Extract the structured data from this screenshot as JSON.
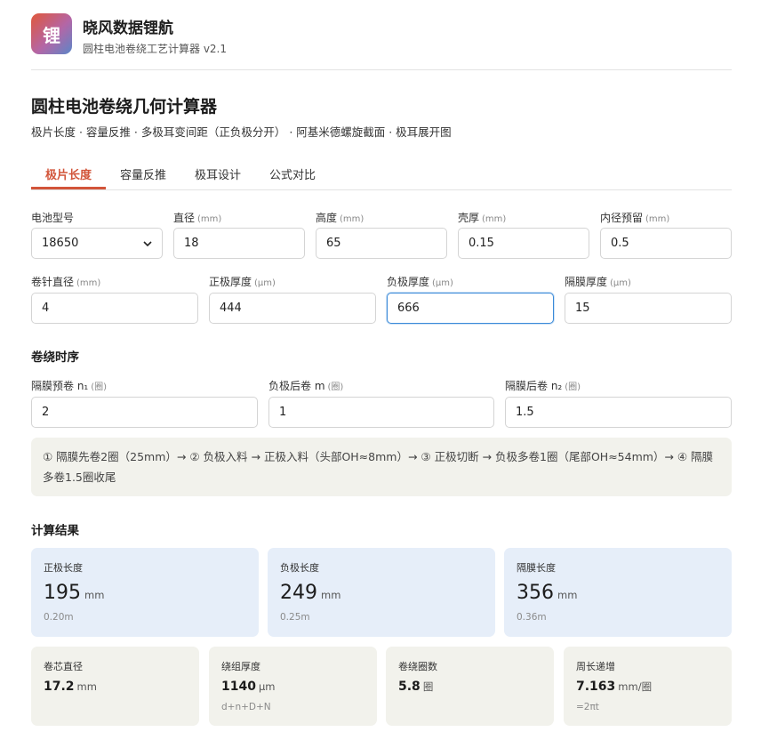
{
  "header": {
    "logo_char": "锂",
    "app_title": "晓风数据锂航",
    "app_subtitle": "圆柱电池卷绕工艺计算器 v2.1"
  },
  "page": {
    "title": "圆柱电池卷绕几何计算器",
    "description": "极片长度 · 容量反推 · 多极耳变间距（正负极分开） · 阿基米德螺旋截面 · 极耳展开图"
  },
  "tabs": [
    {
      "label": "极片长度",
      "active": true
    },
    {
      "label": "容量反推",
      "active": false
    },
    {
      "label": "极耳设计",
      "active": false
    },
    {
      "label": "公式对比",
      "active": false
    }
  ],
  "params_row1": [
    {
      "label": "电池型号",
      "unit": "",
      "value": "18650",
      "type": "select"
    },
    {
      "label": "直径",
      "unit": "(mm)",
      "value": "18"
    },
    {
      "label": "高度",
      "unit": "(mm)",
      "value": "65"
    },
    {
      "label": "壳厚",
      "unit": "(mm)",
      "value": "0.15"
    },
    {
      "label": "内径预留",
      "unit": "(mm)",
      "value": "0.5"
    }
  ],
  "params_row2": [
    {
      "label": "卷针直径",
      "unit": "(mm)",
      "value": "4"
    },
    {
      "label": "正极厚度",
      "unit": "(μm)",
      "value": "444"
    },
    {
      "label": "负极厚度",
      "unit": "(μm)",
      "value": "666"
    },
    {
      "label": "隔膜厚度",
      "unit": "(μm)",
      "value": "15"
    }
  ],
  "winding": {
    "title": "卷绕时序",
    "fields": [
      {
        "label": "隔膜预卷 n₁",
        "unit": "(圈)",
        "value": "2"
      },
      {
        "label": "负极后卷 m",
        "unit": "(圈)",
        "value": "1"
      },
      {
        "label": "隔膜后卷 n₂",
        "unit": "(圈)",
        "value": "1.5"
      }
    ],
    "note": "① 隔膜先卷2圈（25mm）→ ② 负极入料 → 正极入料（头部OH≈8mm）→ ③ 正极切断 → 负极多卷1圈（尾部OH≈54mm）→ ④ 隔膜多卷1.5圈收尾"
  },
  "results": {
    "title": "计算结果",
    "main": [
      {
        "label": "正极长度",
        "value": "195",
        "unit": "mm",
        "sub": "0.20m"
      },
      {
        "label": "负极长度",
        "value": "249",
        "unit": "mm",
        "sub": "0.25m"
      },
      {
        "label": "隔膜长度",
        "value": "356",
        "unit": "mm",
        "sub": "0.36m"
      }
    ],
    "secondary": [
      {
        "label": "卷芯直径",
        "value": "17.2",
        "unit": "mm",
        "sub": ""
      },
      {
        "label": "绕组厚度",
        "value": "1140",
        "unit": "μm",
        "sub": "d+n+D+N"
      },
      {
        "label": "卷绕圈数",
        "value": "5.8",
        "unit": "圈",
        "sub": ""
      },
      {
        "label": "周长递增",
        "value": "7.163",
        "unit": "mm/圈",
        "sub": "=2πt"
      }
    ]
  },
  "colors": {
    "accent": "#d2553a",
    "result_primary_bg": "#e6eef9",
    "result_secondary_bg": "#f2f2ec",
    "focus": "#3b8ad9"
  }
}
